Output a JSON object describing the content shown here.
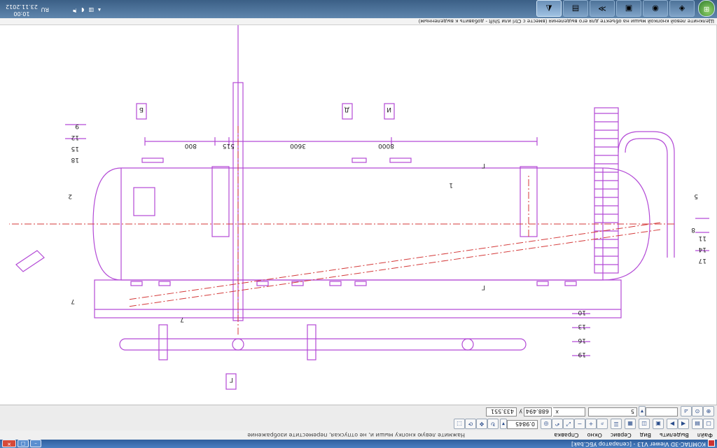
{
  "window": {
    "title": "КОМПАС-3D Viewer V13 - [сепаратор УБС.bak]",
    "buttons": {
      "minimize": "–",
      "maximize": "□",
      "close": "✕"
    }
  },
  "menu": {
    "items": [
      "Файл",
      "Выделить",
      "Вид",
      "Сервис",
      "Окно",
      "Справка"
    ],
    "hint": "Нажмите левую кнопку мыши и, не отпуская, переместите изображение"
  },
  "toolbar": {
    "zoom_value": "0.9845",
    "coord_x": "433.551",
    "coord_y": "688.494",
    "scale_field": "5",
    "labels": {
      "x": "x",
      "y": "y"
    }
  },
  "drawing": {
    "line_color": "#b34ad6",
    "axis_color": "#d43a3a",
    "labels": {
      "section_b": "Б",
      "section_d": "Д",
      "section_i": "И",
      "section_g_bottom": "Г",
      "arrow_g1": "Г",
      "arrow_g2": "Г",
      "dim_800": "800",
      "dim_515": "515",
      "dim_3600": "3600",
      "dim_8000": "8000",
      "pos_1": "1",
      "pos_2": "2",
      "pos_5": "5",
      "pos_7a": "7",
      "pos_7b": "7",
      "pos_8": "8",
      "left_stack": [
        "9",
        "12",
        "15",
        "18"
      ],
      "right_stack": [
        "11",
        "14",
        "17"
      ],
      "bottom_stack": [
        "10",
        "13",
        "16",
        "19"
      ]
    }
  },
  "statusbar": {
    "text": "Щелкните левой кнопкой мыши на объекте для его выделения (вместе с Ctrl или Shift - добавить к выделенным)"
  },
  "taskbar": {
    "start_label": "⊞",
    "apps": [
      "kompas",
      "folder",
      "browser",
      "media",
      "chart",
      "explorer"
    ],
    "tray": {
      "language": "RU",
      "time": "10:00",
      "date": "23.11.2012"
    }
  }
}
